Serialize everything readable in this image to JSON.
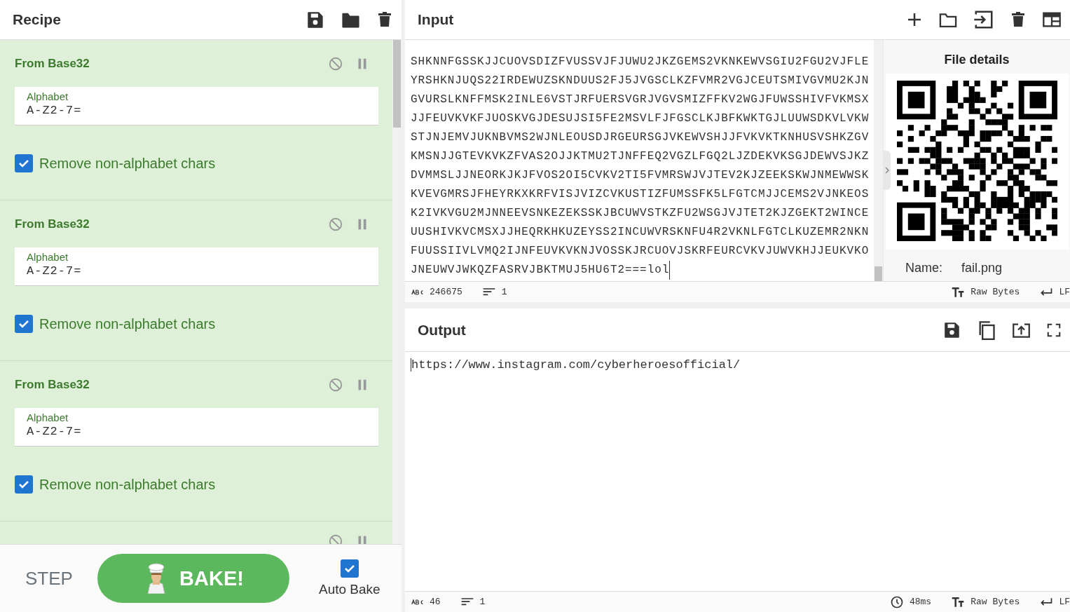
{
  "recipe": {
    "title": "Recipe",
    "operations": [
      {
        "title": "From Base32",
        "alphabet_label": "Alphabet",
        "alphabet": "A-Z2-7=",
        "option_label": "Remove non-alphabet chars",
        "checked": true
      },
      {
        "title": "From Base32",
        "alphabet_label": "Alphabet",
        "alphabet": "A-Z2-7=",
        "option_label": "Remove non-alphabet chars",
        "checked": true
      },
      {
        "title": "From Base32",
        "alphabet_label": "Alphabet",
        "alphabet": "A-Z2-7=",
        "option_label": "Remove non-alphabet chars",
        "checked": true
      }
    ]
  },
  "controls": {
    "step": "STEP",
    "bake": "BAKE!",
    "auto_bake": {
      "label": "Auto Bake",
      "checked": true
    }
  },
  "input": {
    "title": "Input",
    "lines": [
      "SHKNNFGSSKJJCUOVSDIZFVUSSVJFJUWU2JKZGEMS2VKNKEWVSGIU2FGU2VJFLE",
      "YRSHKNJUQS22IRDEWUZSKNDUUS2FJ5JVGSCLKZFVMR2VGJCEUTSMIVGVMU2KJN",
      "GVURSLKNFFMSK2INLE6VSTJRFUERSVGRJVGVSMIZFFKV2WGJFUWSSHIVFVKMSX",
      "JJFEUVKVKFJUOSKVGJDESUJSI5FE2MSVLFJFGSCLKJBFKWKTGJLUUWSDKVLVKW",
      "STJNJEMVJUKNBVMS2WJNLEOUSDJRGEURSGJVKEWVSHJJFVKVKTKNHUSVSHKZGV",
      "KMSNJJGTEVKVKZFVAS2OJJKTMU2TJNFFEQ2VGZLFGQ2LJZDEKVKSGJDEWVSJKZ",
      "DVMMSLJJNEORKJKJFVOS2OI5CVKV2TI5FVMRSWJVJTEV2KJZEEKSKWJNMEWWSK",
      "KVEVGMRSJFHEYRKXKRFVISJVIZCVKUSTIZFUMSSFK5LFGTCMJJCEMS2VJNKEOS",
      "K2IVKVGU2MJNNEEVSNKEZEKSSKJBCUWVSTKZFU2WSGJVJTET2KJZGEKT2WINCE",
      "UUSHIVKVCMSXJJHEQRKHKUZEYSS2INCUWVRSKNFU4R2VKNLFGTCLKUZEMR2NKN",
      "FUUSSIIVLVMQ2IJNFEUVKVKNJVOSSKJRCUOVJSKRFEURCVKVJUWVKHJJEUKVKO",
      "JNEUWVJWKQZFASRVJBKTMUJ5HU6T2===lol"
    ],
    "file_details": {
      "title": "File details",
      "name_label": "Name:",
      "name": "fail.png"
    },
    "status": {
      "length": "246675",
      "lines": "1",
      "encoding": "Raw Bytes",
      "eol": "LF"
    }
  },
  "output": {
    "title": "Output",
    "text": "https://www.instagram.com/cyberheroesofficial/",
    "status": {
      "length": "46",
      "lines": "1",
      "time": "48ms",
      "encoding": "Raw Bytes",
      "eol": "LF"
    }
  }
}
